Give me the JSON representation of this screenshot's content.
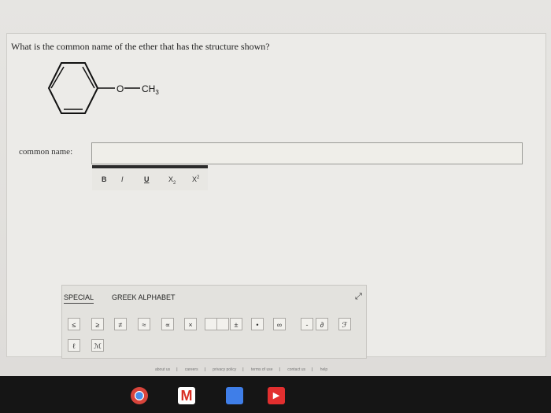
{
  "question": "What is the common name of the ether that has the structure shown?",
  "structure": {
    "left": "O",
    "right": "CH",
    "subscript": "3"
  },
  "answer": {
    "label": "common name:",
    "value": ""
  },
  "format_toolbar": {
    "bold": "B",
    "italic": "I",
    "underline": "U",
    "sub": "X",
    "sub_mark": "2",
    "sup": "X",
    "sup_mark": "2"
  },
  "symbol_panel": {
    "tabs": [
      "SPECIAL",
      "GREEK ALPHABET"
    ],
    "row1": [
      "≤",
      "≥",
      "≠",
      "≈",
      "∝",
      "×",
      "",
      "",
      "±",
      "•",
      "∞",
      "-",
      "∂",
      "ℱ"
    ],
    "row2": [
      "ℓ",
      "ℳ"
    ]
  },
  "footer": [
    "about us",
    "careers",
    "privacy policy",
    "terms of use",
    "contact us",
    "help"
  ]
}
